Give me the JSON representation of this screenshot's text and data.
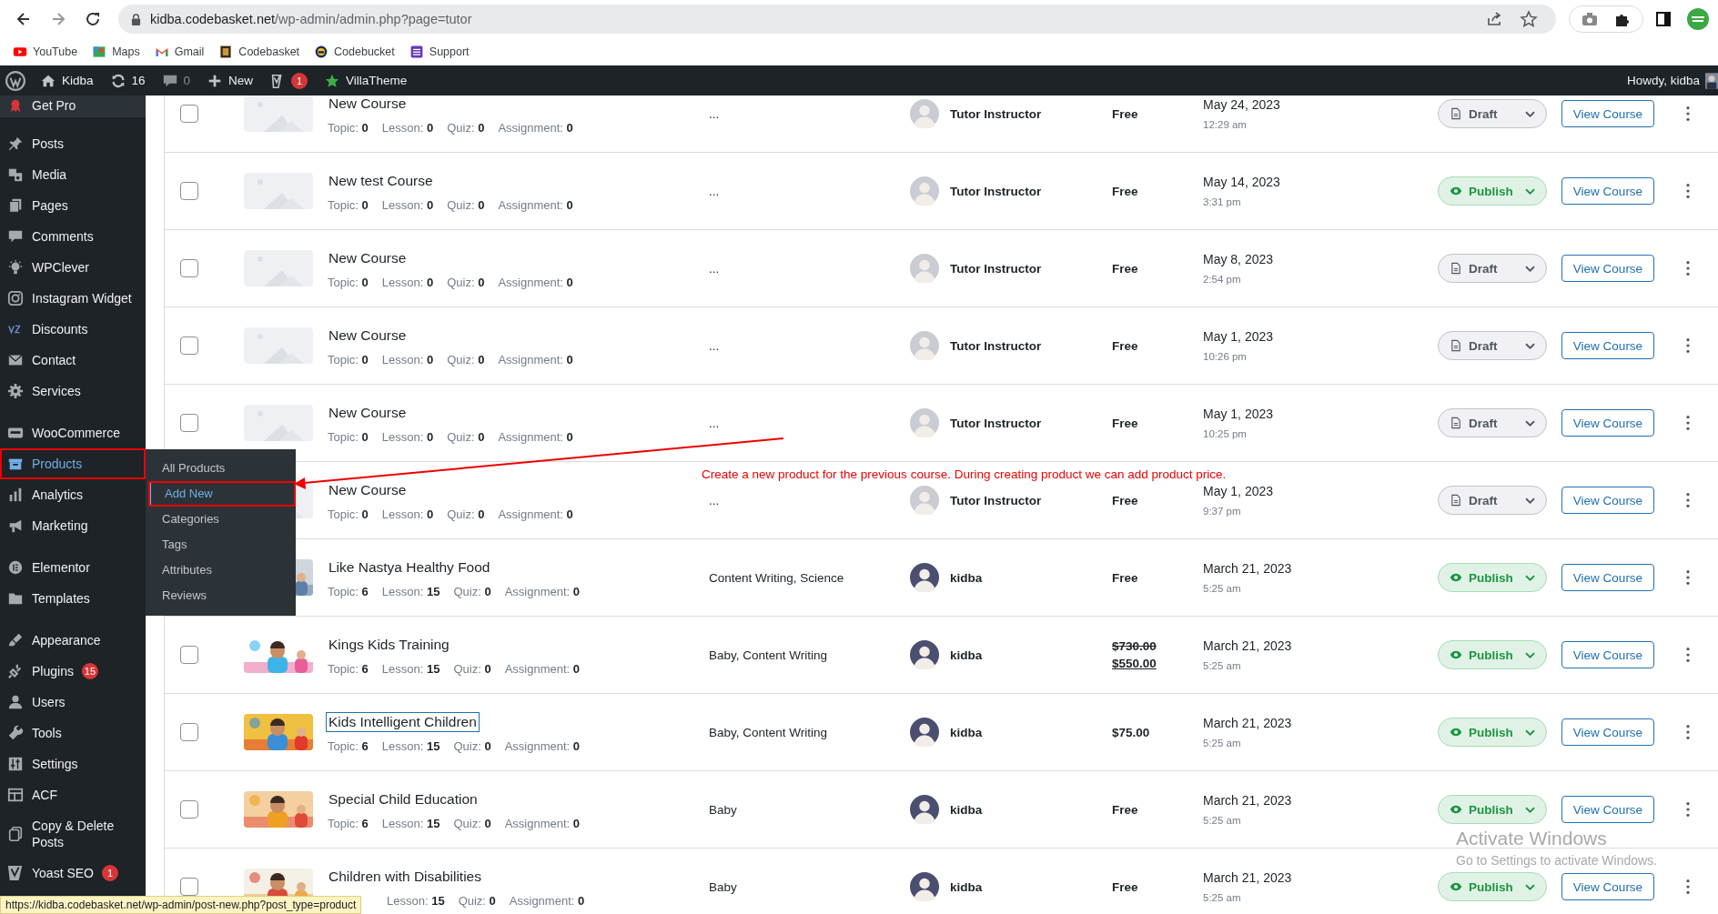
{
  "browser": {
    "url_host": "kidba.codebasket.net",
    "url_path": "/wp-admin/admin.php?page=tutor",
    "bookmarks": [
      {
        "label": "YouTube"
      },
      {
        "label": "Maps"
      },
      {
        "label": "Gmail"
      },
      {
        "label": "Codebasket"
      },
      {
        "label": "Codebucket"
      },
      {
        "label": "Support"
      }
    ]
  },
  "admin_bar": {
    "site": "Kidba",
    "updates": "16",
    "comments": "0",
    "new": "New",
    "yoast_badge": "1",
    "theme": "VillaTheme",
    "howdy": "Howdy, kidba"
  },
  "sidebar": {
    "groups": [
      [
        {
          "label": "Get Pro",
          "selected": false
        }
      ],
      [
        {
          "label": "Posts",
          "selected": false
        },
        {
          "label": "Media",
          "selected": false
        },
        {
          "label": "Pages",
          "selected": false
        },
        {
          "label": "Comments",
          "selected": false
        },
        {
          "label": "WPClever",
          "selected": false
        },
        {
          "label": "Instagram Widget",
          "selected": false
        },
        {
          "label": "Discounts",
          "selected": false
        },
        {
          "label": "Contact",
          "selected": false
        },
        {
          "label": "Services",
          "selected": false
        }
      ],
      [
        {
          "label": "WooCommerce",
          "selected": false
        },
        {
          "label": "Products",
          "selected": true,
          "annotated": true
        },
        {
          "label": "Analytics",
          "selected": false
        },
        {
          "label": "Marketing",
          "selected": false
        }
      ],
      [
        {
          "label": "Elementor",
          "selected": false
        },
        {
          "label": "Templates",
          "selected": false
        }
      ],
      [
        {
          "label": "Appearance",
          "selected": false
        },
        {
          "label": "Plugins",
          "selected": false,
          "badge": "15"
        },
        {
          "label": "Users",
          "selected": false
        },
        {
          "label": "Tools",
          "selected": false
        },
        {
          "label": "Settings",
          "selected": false
        },
        {
          "label": "ACF",
          "selected": false
        },
        {
          "label": "Copy & Delete Posts",
          "selected": false
        },
        {
          "label": "Yoast SEO",
          "selected": false,
          "badge": "1"
        }
      ]
    ]
  },
  "submenu": [
    {
      "label": "All Products",
      "selected": false
    },
    {
      "label": "Add New",
      "selected": true,
      "annotated": true
    },
    {
      "label": "Categories",
      "selected": false
    },
    {
      "label": "Tags",
      "selected": false
    },
    {
      "label": "Attributes",
      "selected": false
    },
    {
      "label": "Reviews",
      "selected": false
    }
  ],
  "table": {
    "rows": [
      {
        "checked": false,
        "thumb": {
          "kind": "placeholder"
        },
        "title": "New Course",
        "focused": false,
        "meta": [
          {
            "label": "Topic:",
            "value": "0"
          },
          {
            "label": "Lesson:",
            "value": "0"
          },
          {
            "label": "Quiz:",
            "value": "0"
          },
          {
            "label": "Assignment:",
            "value": "0"
          }
        ],
        "category": "...",
        "author": "Tutor Instructor",
        "price": "Free",
        "date": "May 24, 2023",
        "time": "12:29 am",
        "status": {
          "kind": "draft",
          "label": "Draft"
        },
        "action": "View Course"
      },
      {
        "checked": false,
        "thumb": {
          "kind": "placeholder"
        },
        "title": "New test Course",
        "focused": false,
        "meta": [
          {
            "label": "Topic:",
            "value": "0"
          },
          {
            "label": "Lesson:",
            "value": "0"
          },
          {
            "label": "Quiz:",
            "value": "0"
          },
          {
            "label": "Assignment:",
            "value": "0"
          }
        ],
        "category": "...",
        "author": "Tutor Instructor",
        "price": "Free",
        "date": "May 14, 2023",
        "time": "3:31 pm",
        "status": {
          "kind": "publish",
          "label": "Publish"
        },
        "action": "View Course"
      },
      {
        "checked": false,
        "thumb": {
          "kind": "placeholder"
        },
        "title": "New Course",
        "focused": false,
        "meta": [
          {
            "label": "Topic:",
            "value": "0"
          },
          {
            "label": "Lesson:",
            "value": "0"
          },
          {
            "label": "Quiz:",
            "value": "0"
          },
          {
            "label": "Assignment:",
            "value": "0"
          }
        ],
        "category": "...",
        "author": "Tutor Instructor",
        "price": "Free",
        "date": "May 8, 2023",
        "time": "2:54 pm",
        "status": {
          "kind": "draft",
          "label": "Draft"
        },
        "action": "View Course"
      },
      {
        "checked": false,
        "thumb": {
          "kind": "placeholder"
        },
        "title": "New Course",
        "focused": false,
        "meta": [
          {
            "label": "Topic:",
            "value": "0"
          },
          {
            "label": "Lesson:",
            "value": "0"
          },
          {
            "label": "Quiz:",
            "value": "0"
          },
          {
            "label": "Assignment:",
            "value": "0"
          }
        ],
        "category": "...",
        "author": "Tutor Instructor",
        "price": "Free",
        "date": "May 1, 2023",
        "time": "10:26 pm",
        "status": {
          "kind": "draft",
          "label": "Draft"
        },
        "action": "View Course"
      },
      {
        "checked": false,
        "thumb": {
          "kind": "placeholder"
        },
        "title": "New Course",
        "focused": false,
        "meta": [
          {
            "label": "Topic:",
            "value": "0"
          },
          {
            "label": "Lesson:",
            "value": "0"
          },
          {
            "label": "Quiz:",
            "value": "0"
          },
          {
            "label": "Assignment:",
            "value": "0"
          }
        ],
        "category": "...",
        "author": "Tutor Instructor",
        "price": "Free",
        "date": "May 1, 2023",
        "time": "10:25 pm",
        "status": {
          "kind": "draft",
          "label": "Draft"
        },
        "action": "View Course"
      },
      {
        "thumb": {
          "kind": "placeholder"
        },
        "title": "New Course",
        "focused": false,
        "meta": [
          {
            "label": "Topic:",
            "value": "0"
          },
          {
            "label": "Lesson:",
            "value": "0"
          },
          {
            "label": "Quiz:",
            "value": "0"
          },
          {
            "label": "Assignment:",
            "value": "0"
          }
        ],
        "category": "...",
        "author": "Tutor Instructor",
        "price": "Free",
        "date": "May 1, 2023",
        "time": "9:37 pm",
        "status": {
          "kind": "draft",
          "label": "Draft"
        },
        "action": "View Course"
      },
      {
        "thumb": {
          "kind": "picture"
        },
        "title": "Like Nastya Healthy Food",
        "focused": false,
        "meta": [
          {
            "label": "Topic:",
            "value": "6"
          },
          {
            "label": "Lesson:",
            "value": "15"
          },
          {
            "label": "Quiz:",
            "value": "0"
          },
          {
            "label": "Assignment:",
            "value": "0"
          }
        ],
        "category": "Content Writing, Science",
        "author": "kidba",
        "price": "Free",
        "date": "March 21, 2023",
        "time": "5:25 am",
        "status": {
          "kind": "publish",
          "label": "Publish"
        },
        "action": "View Course"
      },
      {
        "checked": false,
        "thumb": {
          "kind": "picture"
        },
        "title": "Kings Kids Training",
        "focused": false,
        "meta": [
          {
            "label": "Topic:",
            "value": "6"
          },
          {
            "label": "Lesson:",
            "value": "15"
          },
          {
            "label": "Quiz:",
            "value": "0"
          },
          {
            "label": "Assignment:",
            "value": "0"
          }
        ],
        "category": "Baby, Content Writing",
        "author": "kidba",
        "original_price": "$730.00",
        "price": "$550.00",
        "date": "March 21, 2023",
        "time": "5:25 am",
        "status": {
          "kind": "publish",
          "label": "Publish"
        },
        "action": "View Course"
      },
      {
        "checked": false,
        "thumb": {
          "kind": "picture"
        },
        "title": "Kids Intelligent Children",
        "focused": true,
        "meta": [
          {
            "label": "Topic:",
            "value": "6"
          },
          {
            "label": "Lesson:",
            "value": "15"
          },
          {
            "label": "Quiz:",
            "value": "0"
          },
          {
            "label": "Assignment:",
            "value": "0"
          }
        ],
        "category": "Baby, Content Writing",
        "author": "kidba",
        "price": "$75.00",
        "date": "March 21, 2023",
        "time": "5:25 am",
        "status": {
          "kind": "publish",
          "label": "Publish"
        },
        "action": "View Course"
      },
      {
        "checked": false,
        "thumb": {
          "kind": "picture"
        },
        "title": "Special Child Education",
        "focused": false,
        "meta": [
          {
            "label": "Topic:",
            "value": "6"
          },
          {
            "label": "Lesson:",
            "value": "15"
          },
          {
            "label": "Quiz:",
            "value": "0"
          },
          {
            "label": "Assignment:",
            "value": "0"
          }
        ],
        "category": "Baby",
        "author": "kidba",
        "price": "Free",
        "date": "March 21, 2023",
        "time": "5:25 am",
        "status": {
          "kind": "publish",
          "label": "Publish"
        },
        "action": "View Course"
      },
      {
        "checked": false,
        "thumb": {
          "kind": "picture"
        },
        "title": "Children with Disabilities",
        "focused": false,
        "meta": [
          {
            "label": "Lesson:",
            "value": "15"
          },
          {
            "label": "Quiz:",
            "value": "0"
          },
          {
            "label": "Assignment:",
            "value": "0"
          }
        ],
        "category": "Baby",
        "author": "kidba",
        "price": "Free",
        "date": "March 21, 2023",
        "time": "5:25 am",
        "status": {
          "kind": "publish",
          "label": "Publish"
        },
        "action": "View Course"
      }
    ]
  },
  "annotation": {
    "text": "Create a new product for the previous course. During creating product we can add product price."
  },
  "os_notice": {
    "title": "Activate Windows",
    "text": "Go to Settings to activate Windows."
  },
  "status_link": "https://kidba.codebasket.net/wp-admin/post-new.php?post_type=product"
}
